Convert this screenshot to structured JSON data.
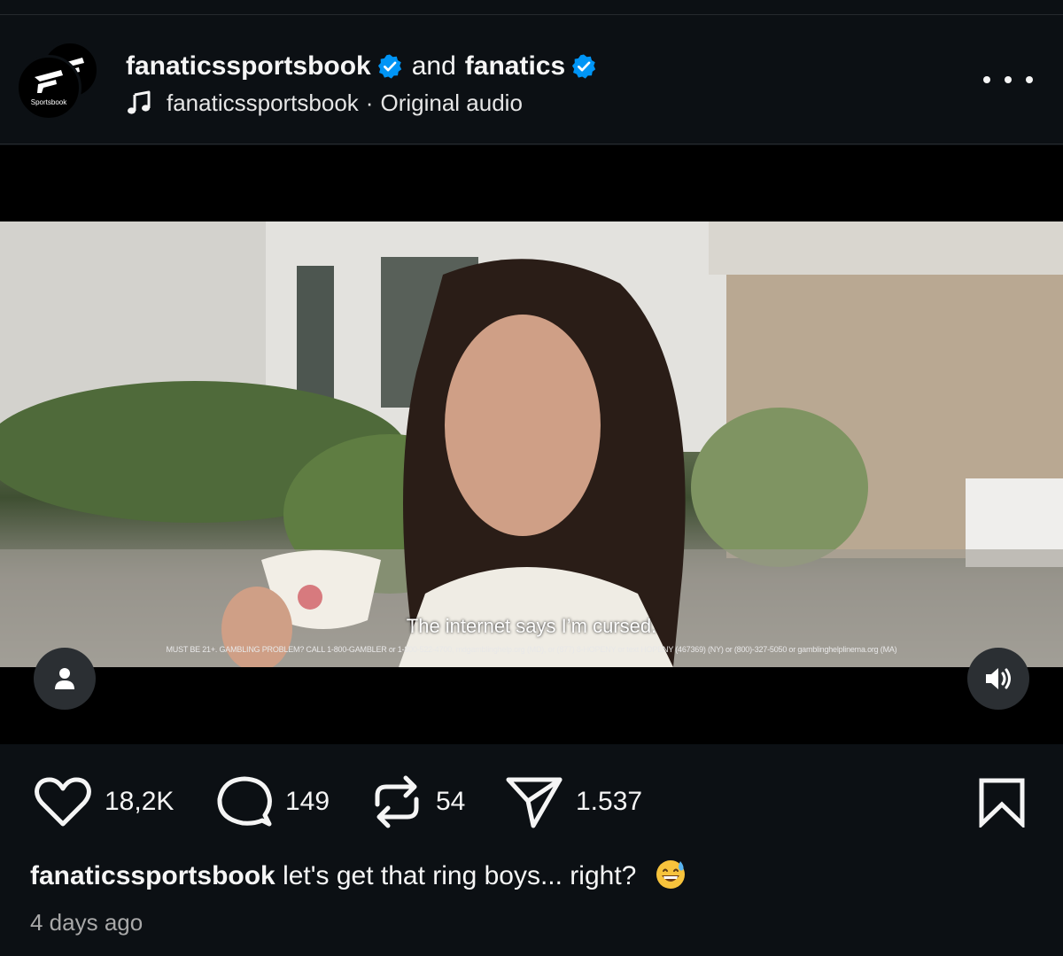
{
  "header": {
    "avatar_back_label": "Fanatics",
    "avatar_front_label": "Sportsbook",
    "user_primary": "fanaticssportsbook",
    "conjunction": "and",
    "user_secondary": "fanatics",
    "audio_user": "fanaticssportsbook",
    "audio_separator": "·",
    "audio_label": "Original audio",
    "more_icon": "more-horizontal-icon"
  },
  "media": {
    "subtitle": "The internet says I’m cursed.",
    "disclaimer": "MUST BE 21+. GAMBLING PROBLEM? CALL 1-800-GAMBLER or 1-800-522-4700, mdgamblinghelp.org (MD), or (877) 8-HOPENY or text HOPENY (467369) (NY) or (800)-327-5050 or gamblinghelplinema.org (MA)",
    "user_tag_icon": "person-icon",
    "sound_icon": "speaker-on-icon"
  },
  "actions": {
    "likes": "18,2K",
    "comments": "149",
    "reposts": "54",
    "shares": "1.537"
  },
  "caption": {
    "user": "fanaticssportsbook",
    "text": "let's get that ring boys... right?",
    "emoji": "grinning-face-with-sweat"
  },
  "timestamp": "4 days ago",
  "colors": {
    "background": "#0c1014",
    "verified": "#0095f6",
    "text": "#f5f5f5",
    "muted": "#a8a8a8"
  }
}
